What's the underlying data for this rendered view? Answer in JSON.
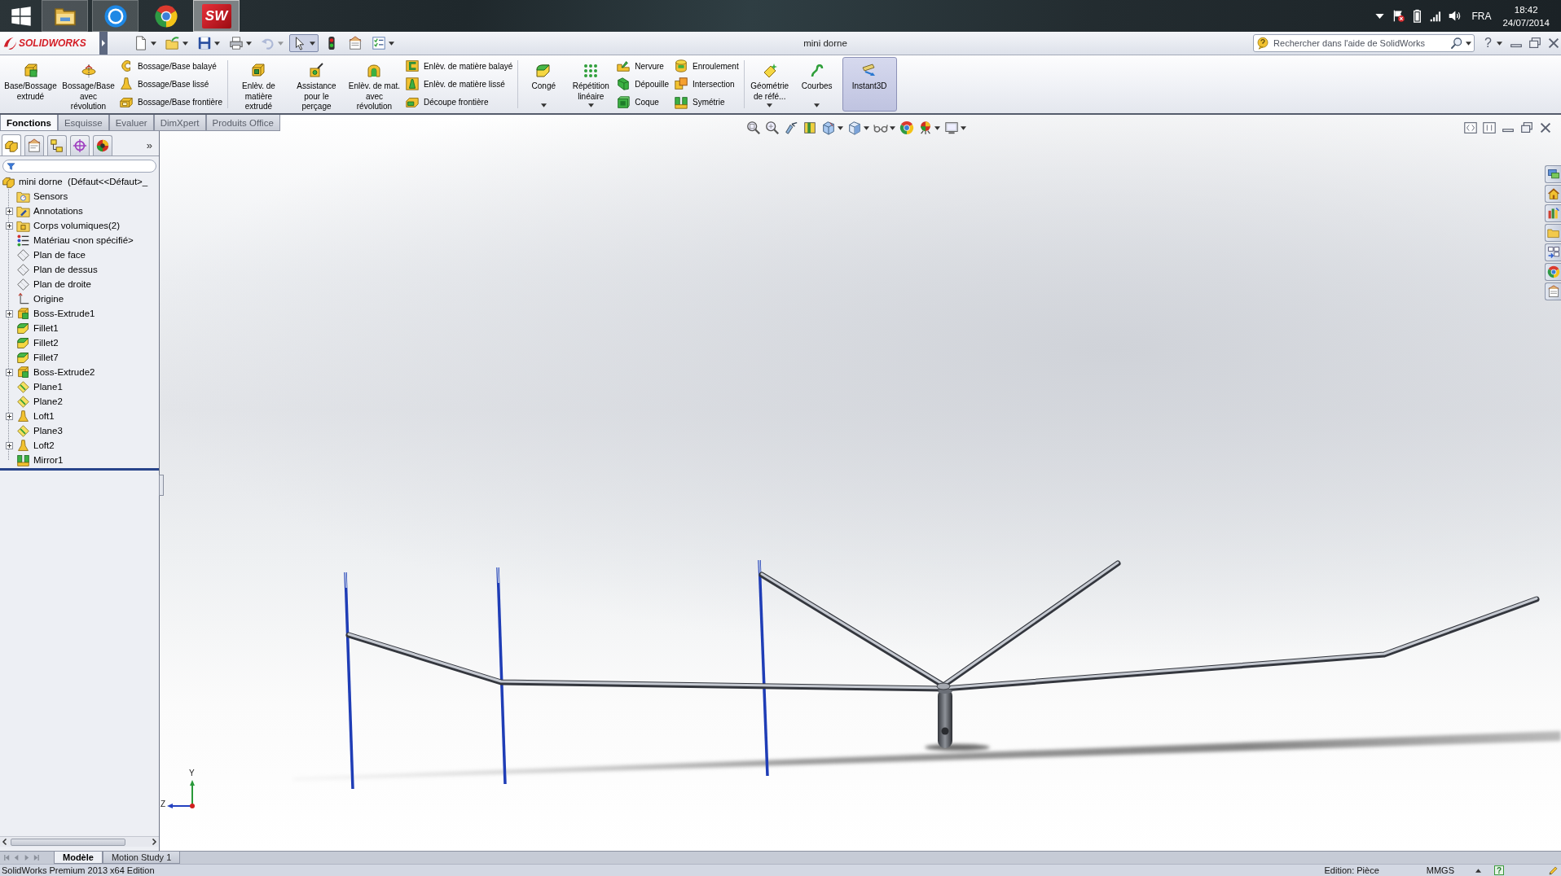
{
  "taskbar": {
    "apps": [
      {
        "kind": "explorer",
        "running": true,
        "selected": false
      },
      {
        "kind": "ring",
        "running": true,
        "selected": false
      },
      {
        "kind": "tri-ball",
        "running": false,
        "selected": false
      },
      {
        "kind": "logo",
        "label": "SW",
        "running": true,
        "selected": true
      }
    ]
  },
  "tray": {
    "language": "FRA",
    "time": "18:42",
    "date": "24/07/2014"
  },
  "title_bar": {
    "logo": "SOLIDWORKS",
    "title": "mini dorne",
    "search": {
      "placeholder": "Rechercher dans l'aide de SolidWorks"
    },
    "help": "?"
  },
  "quick_access": [
    {
      "kind": "new",
      "dropdown": true,
      "selected": false,
      "disabled": false
    },
    {
      "kind": "open",
      "dropdown": true,
      "selected": false,
      "disabled": false
    },
    {
      "kind": "save",
      "dropdown": true,
      "selected": false,
      "disabled": false
    },
    {
      "kind": "print",
      "dropdown": true,
      "selected": false,
      "disabled": false
    },
    {
      "kind": "undo",
      "dropdown": true,
      "selected": false,
      "disabled": true
    },
    {
      "kind": "select",
      "dropdown": true,
      "selected": true,
      "disabled": false
    },
    {
      "kind": "rebuild",
      "dropdown": false,
      "selected": false,
      "disabled": false
    },
    {
      "kind": "file-properties",
      "dropdown": false,
      "selected": false,
      "disabled": false
    },
    {
      "kind": "options",
      "dropdown": true,
      "selected": false,
      "disabled": false
    }
  ],
  "command_manager": {
    "groups": [
      {
        "buttons": [
          {
            "kind": "extrude",
            "label": "Base/Bossage extrudé",
            "dropdown": false,
            "selected": false
          },
          {
            "kind": "revolve",
            "label": "Bossage/Base avec révolution",
            "dropdown": false,
            "selected": false
          }
        ],
        "stacks": [
          {
            "items": [
              {
                "kind": "sweep",
                "label": "Bossage/Base balayé"
              },
              {
                "kind": "loft",
                "label": "Bossage/Base lissé"
              },
              {
                "kind": "boundary",
                "label": "Bossage/Base frontière"
              }
            ]
          }
        ]
      },
      {
        "buttons": [
          {
            "kind": "cut-extrude",
            "label": "Enlèv. de matière extrudé",
            "dropdown": false,
            "selected": false
          },
          {
            "kind": "hole-wizard",
            "label": "Assistance pour le perçage",
            "dropdown": false,
            "selected": false
          },
          {
            "kind": "cut-revolve",
            "label": "Enlèv. de mat. avec révolution",
            "dropdown": false,
            "selected": false
          }
        ],
        "stacks": [
          {
            "items": [
              {
                "kind": "cut-sweep",
                "label": "Enlèv. de matière balayé"
              },
              {
                "kind": "cut-loft",
                "label": "Enlèv. de matière lissé"
              },
              {
                "kind": "boundary-cut",
                "label": "Découpe frontière"
              }
            ]
          }
        ]
      },
      {
        "buttons": [
          {
            "kind": "fillet",
            "label": "Congé",
            "dropdown": true,
            "selected": false
          },
          {
            "kind": "linear-pattern",
            "label": "Répétition linéaire",
            "dropdown": true,
            "selected": false
          }
        ],
        "stacks": [
          {
            "items": [
              {
                "kind": "rib",
                "label": "Nervure"
              },
              {
                "kind": "draft",
                "label": "Dépouille"
              },
              {
                "kind": "shell",
                "label": "Coque"
              }
            ]
          },
          {
            "items": [
              {
                "kind": "wrap",
                "label": "Enroulement"
              },
              {
                "kind": "intersect",
                "label": "Intersection"
              },
              {
                "kind": "mirror",
                "label": "Symétrie"
              }
            ]
          }
        ]
      },
      {
        "buttons": [
          {
            "kind": "ref-geometry",
            "label": "Géométrie de réfé...",
            "dropdown": true,
            "selected": false
          },
          {
            "kind": "curves",
            "label": "Courbes",
            "dropdown": true,
            "selected": false
          },
          {
            "kind": "instant3d",
            "label": "Instant3D",
            "dropdown": false,
            "selected": true
          }
        ]
      }
    ]
  },
  "command_tabs": [
    {
      "label": "Fonctions",
      "selected": true
    },
    {
      "label": "Esquisse",
      "selected": false
    },
    {
      "label": "Evaluer",
      "selected": false
    },
    {
      "label": "DimXpert",
      "selected": false
    },
    {
      "label": "Produits Office",
      "selected": false
    }
  ],
  "left_panel": {
    "tabs": [
      {
        "kind": "feature-manager",
        "selected": true
      },
      {
        "kind": "property-manager",
        "selected": false
      },
      {
        "kind": "configuration-manager",
        "selected": false
      },
      {
        "kind": "dimxpert",
        "selected": false
      },
      {
        "kind": "display-manager",
        "selected": false
      }
    ],
    "more": "»"
  },
  "tree": {
    "label": "mini dorne  (Défaut<<Défaut>_",
    "kind": "part",
    "children": [
      {
        "label": "Sensors",
        "kind": "sensors",
        "expandable": false
      },
      {
        "label": "Annotations",
        "kind": "annotations",
        "expandable": true
      },
      {
        "label": "Corps volumiques(2)",
        "kind": "bodies",
        "expandable": true
      },
      {
        "label": "Matériau <non spécifié>",
        "kind": "material",
        "expandable": false
      },
      {
        "label": "Plan de face",
        "kind": "plane",
        "expandable": false
      },
      {
        "label": "Plan de dessus",
        "kind": "plane",
        "expandable": false
      },
      {
        "label": "Plan de droite",
        "kind": "plane",
        "expandable": false
      },
      {
        "label": "Origine",
        "kind": "origin",
        "expandable": false
      },
      {
        "label": "Boss-Extrude1",
        "kind": "extrude",
        "expandable": true
      },
      {
        "label": "Fillet1",
        "kind": "fillet",
        "expandable": false
      },
      {
        "label": "Fillet2",
        "kind": "fillet",
        "expandable": false
      },
      {
        "label": "Fillet7",
        "kind": "fillet",
        "expandable": false
      },
      {
        "label": "Boss-Extrude2",
        "kind": "extrude",
        "expandable": true
      },
      {
        "label": "Plane1",
        "kind": "ref-plane",
        "expandable": false
      },
      {
        "label": "Plane2",
        "kind": "ref-plane",
        "expandable": false
      },
      {
        "label": "Loft1",
        "kind": "loft",
        "expandable": true
      },
      {
        "label": "Plane3",
        "kind": "ref-plane",
        "expandable": false
      },
      {
        "label": "Loft2",
        "kind": "loft",
        "expandable": true
      },
      {
        "label": "Mirror1",
        "kind": "mirror",
        "expandable": false
      }
    ]
  },
  "viewport": {
    "view_toolbar": [
      {
        "kind": "zoom-fit",
        "dropdown": false
      },
      {
        "kind": "zoom-area",
        "dropdown": false
      },
      {
        "kind": "previous-view",
        "dropdown": false
      },
      {
        "kind": "section-view",
        "dropdown": false
      },
      {
        "kind": "view-orientation",
        "dropdown": true
      },
      {
        "kind": "display-style",
        "dropdown": true
      },
      {
        "kind": "hide-show",
        "dropdown": true
      },
      {
        "kind": "edit-appearance",
        "dropdown": false
      },
      {
        "kind": "apply-scene",
        "dropdown": true
      },
      {
        "kind": "view-settings",
        "dropdown": true
      }
    ],
    "task_pane": [
      {
        "kind": "resources"
      },
      {
        "kind": "home"
      },
      {
        "kind": "design-library"
      },
      {
        "kind": "file-explorer"
      },
      {
        "kind": "view-palette"
      },
      {
        "kind": "appearances"
      },
      {
        "kind": "custom-properties"
      }
    ],
    "triad": {
      "vertical_label": "Y",
      "horizontal_label": "Z"
    }
  },
  "bottom_tabs": [
    {
      "label": "Modèle",
      "selected": true
    },
    {
      "label": "Motion Study 1",
      "selected": false
    }
  ],
  "status_bar": {
    "product": "SolidWorks Premium 2013 x64 Edition",
    "mode": "Edition: Pièce",
    "units": "MMGS",
    "help": "?"
  }
}
